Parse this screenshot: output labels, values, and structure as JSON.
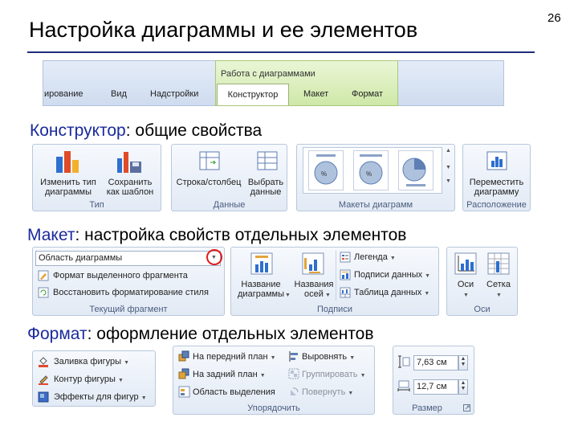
{
  "slide": {
    "title": "Настройка диаграммы и ее элементов",
    "page_number": "26"
  },
  "ribbon_tabs": {
    "partial_tab": "ирование",
    "tab_view": "Вид",
    "tab_addins": "Надстройки",
    "context_group": "Работа с диаграммами",
    "tab_design": "Конструктор",
    "tab_layout": "Макет",
    "tab_format": "Формат"
  },
  "sections": {
    "design": {
      "keyword": "Конструктор",
      "rest": ": общие свойства"
    },
    "layout": {
      "keyword": "Макет",
      "rest": ": настройка свойств отдельных элементов"
    },
    "format": {
      "keyword": "Формат",
      "rest": ": оформление отдельных элементов"
    }
  },
  "design_ribbon": {
    "type_group": {
      "change_type_1": "Изменить тип",
      "change_type_2": "диаграммы",
      "save_tpl_1": "Сохранить",
      "save_tpl_2": "как шаблон",
      "label": "Тип"
    },
    "data_group": {
      "row_col": "Строка/столбец",
      "select_1": "Выбрать",
      "select_2": "данные",
      "label": "Данные"
    },
    "layouts_group": {
      "label": "Макеты диаграмм"
    },
    "location_group": {
      "move_1": "Переместить",
      "move_2": "диаграмму",
      "label": "Расположение"
    }
  },
  "layout_ribbon": {
    "current_selection": {
      "dropdown_value": "Область диаграммы",
      "format_selection": "Формат выделенного фрагмента",
      "reset_style": "Восстановить форматирование стиля",
      "label": "Текущий фрагмент"
    },
    "labels_group": {
      "chart_title_1": "Название",
      "chart_title_2": "диаграммы",
      "axis_titles_1": "Названия",
      "axis_titles_2": "осей",
      "legend": "Легенда",
      "data_labels": "Подписи данных",
      "data_table": "Таблица данных",
      "label": "Подписи"
    },
    "axes_group": {
      "axes": "Оси",
      "gridlines": "Сетка",
      "label": "Оси"
    }
  },
  "format_ribbon": {
    "shape_styles": {
      "fill": "Заливка фигуры",
      "outline": "Контур фигуры",
      "effects": "Эффекты для фигур"
    },
    "arrange_group": {
      "bring_forward": "На передний план",
      "send_backward": "На задний план",
      "selection_pane": "Область выделения",
      "align": "Выровнять",
      "group": "Группировать",
      "rotate": "Повернуть",
      "label": "Упорядочить"
    },
    "size_group": {
      "height": "7,63 см",
      "width": "12,7 см",
      "label": "Размер"
    }
  },
  "colors": {
    "keyword": "#1a2a9c",
    "highlight_circle": "#e01c1c",
    "context_tab": "#cfe8a8"
  }
}
